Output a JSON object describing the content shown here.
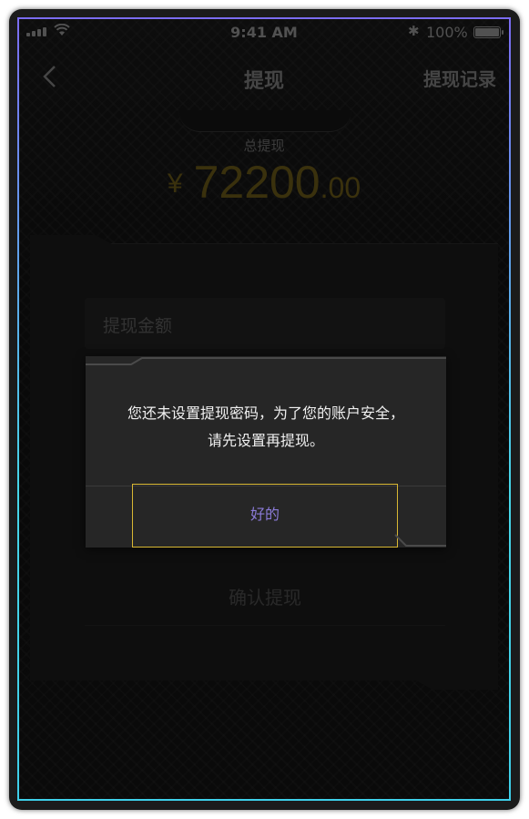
{
  "status_bar": {
    "time": "9:41 AM",
    "bluetooth": "✱",
    "battery_percent": "100%",
    "battery_level": 1.0
  },
  "nav": {
    "back_icon": "chevron-left-icon",
    "title": "提现",
    "records_label": "提现记录"
  },
  "summary": {
    "label": "总提现",
    "currency": "¥",
    "amount_integer": "72200",
    "amount_decimal": ".00"
  },
  "form": {
    "amount_placeholder": "提现金额",
    "confirm_label": "确认提现"
  },
  "dialog": {
    "message_line1": "您还未设置提现密码，为了您的账户安全，",
    "message_line2": "请先设置再提现。",
    "ok_label": "好的"
  },
  "colors": {
    "frame_border_top": "#7b6cf2",
    "frame_border_bottom": "#3ecfe9",
    "amount_gold": "#5a4c14",
    "ok_text": "#8b7bd8",
    "ok_border": "#d8b733"
  }
}
